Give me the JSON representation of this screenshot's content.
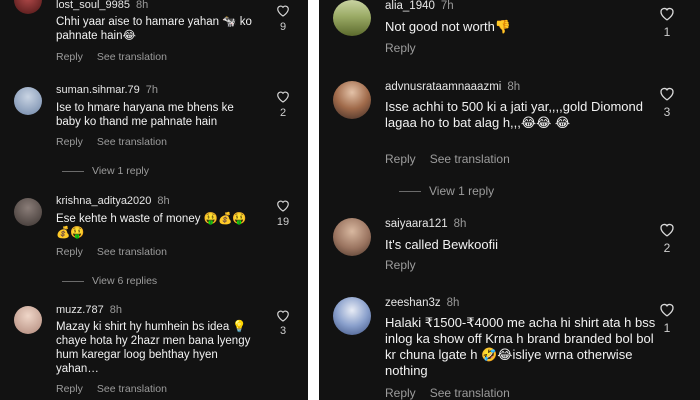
{
  "left_panel": {
    "comments": [
      {
        "username": "lost_soul_9985",
        "time": "8h",
        "text": "Chhi yaar aise to hamare yahan 🐄 ko pahnate hain😂",
        "reply": "Reply",
        "see_translation": "See translation",
        "likes": "9"
      },
      {
        "username": "suman.sihmar.79",
        "time": "7h",
        "text": "Ise to hmare haryana me bhens ke baby ko thand me pahnate hain",
        "reply": "Reply",
        "see_translation": "See translation",
        "likes": "2",
        "view_replies": "View 1 reply"
      },
      {
        "username": "krishna_aditya2020",
        "time": "8h",
        "text": "Ese kehte h waste of money 🤑💰🤑 💰🤑",
        "reply": "Reply",
        "see_translation": "See translation",
        "likes": "19",
        "view_replies": "View 6 replies"
      },
      {
        "username": "muzz.787",
        "time": "8h",
        "text": "Mazay ki shirt hy humhein bs idea 💡 chaye hota hy 2hazr men bana lyengy hum karegar loog behthay hyen yahan…",
        "reply": "Reply",
        "see_translation": "See translation",
        "likes": "3"
      }
    ]
  },
  "right_panel": {
    "comments": [
      {
        "username": "alia_1940",
        "time": "7h",
        "text": "Not good not worth👎",
        "reply": "Reply",
        "likes": "1"
      },
      {
        "username": "advnusrataamnaaazmi",
        "time": "8h",
        "text": "Isse achhi to 500 ki a jati yar,,,,gold Diomond lagaa ho to bat alag h,,,😂😂 😂",
        "reply": "Reply",
        "see_translation": "See translation",
        "likes": "3",
        "view_replies": "View 1 reply"
      },
      {
        "username": "saiyaara121",
        "time": "8h",
        "text": "It's called Bewkoofii",
        "reply": "Reply",
        "likes": "2"
      },
      {
        "username": "zeeshan3z",
        "time": "8h",
        "text": "Halaki ₹1500-₹4000 me acha hi shirt ata h bss inlog ka show off Krna h brand branded bol bol kr chuna lgate h 🤣😂isliye wrna otherwise nothing",
        "reply": "Reply",
        "see_translation": "See translation",
        "likes": "1"
      }
    ]
  },
  "avatar_colors": [
    "#7a2a2a",
    "#8fa3c0",
    "#6a5f5a",
    "#d8b8a8",
    "#6f7d3a",
    "#b48a70",
    "#a58a6a",
    "#5a7ab8"
  ]
}
